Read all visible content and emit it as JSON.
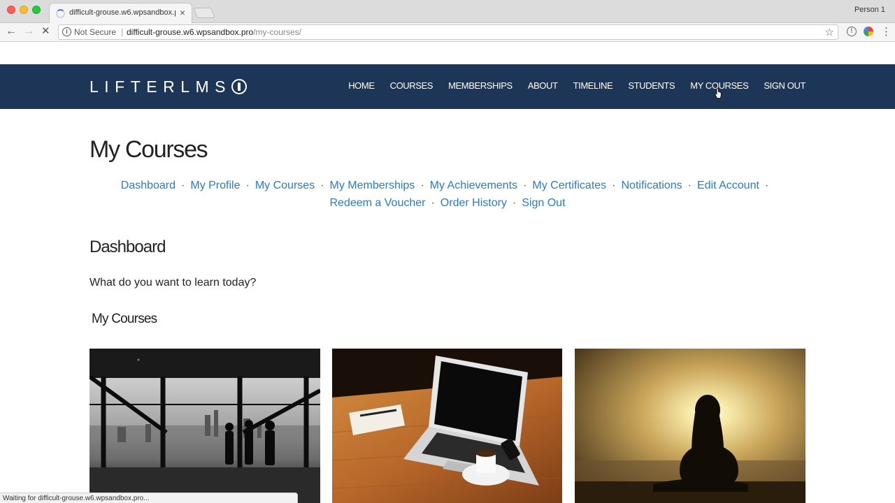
{
  "browser": {
    "tab_title": "difficult-grouse.w6.wpsandbox.pro",
    "profile": "Person 1",
    "security_label": "Not Secure",
    "url_host": "difficult-grouse.w6.wpsandbox.pro",
    "url_path": "/my-courses/",
    "status_text": "Waiting for difficult-grouse.w6.wpsandbox.pro..."
  },
  "site": {
    "logo_text": "LIFTERLMS",
    "nav": [
      "HOME",
      "COURSES",
      "MEMBERSHIPS",
      "ABOUT",
      "TIMELINE",
      "STUDENTS",
      "MY COURSES",
      "SIGN OUT"
    ],
    "header_color": "#1d3557"
  },
  "page": {
    "title": "My Courses",
    "account_nav": [
      "Dashboard",
      "My Profile",
      "My Courses",
      "My Memberships",
      "My Achievements",
      "My Certificates",
      "Notifications",
      "Edit Account",
      "Redeem a Voucher",
      "Order History",
      "Sign Out"
    ],
    "section_title": "Dashboard",
    "section_text": "What do you want to learn today?",
    "courses_title": "My Courses",
    "link_color": "#2a7cc4"
  },
  "courses": [
    {
      "image": "office-silhouettes-photo"
    },
    {
      "image": "laptop-desk-photo"
    },
    {
      "image": "meditation-sunset-photo"
    }
  ]
}
